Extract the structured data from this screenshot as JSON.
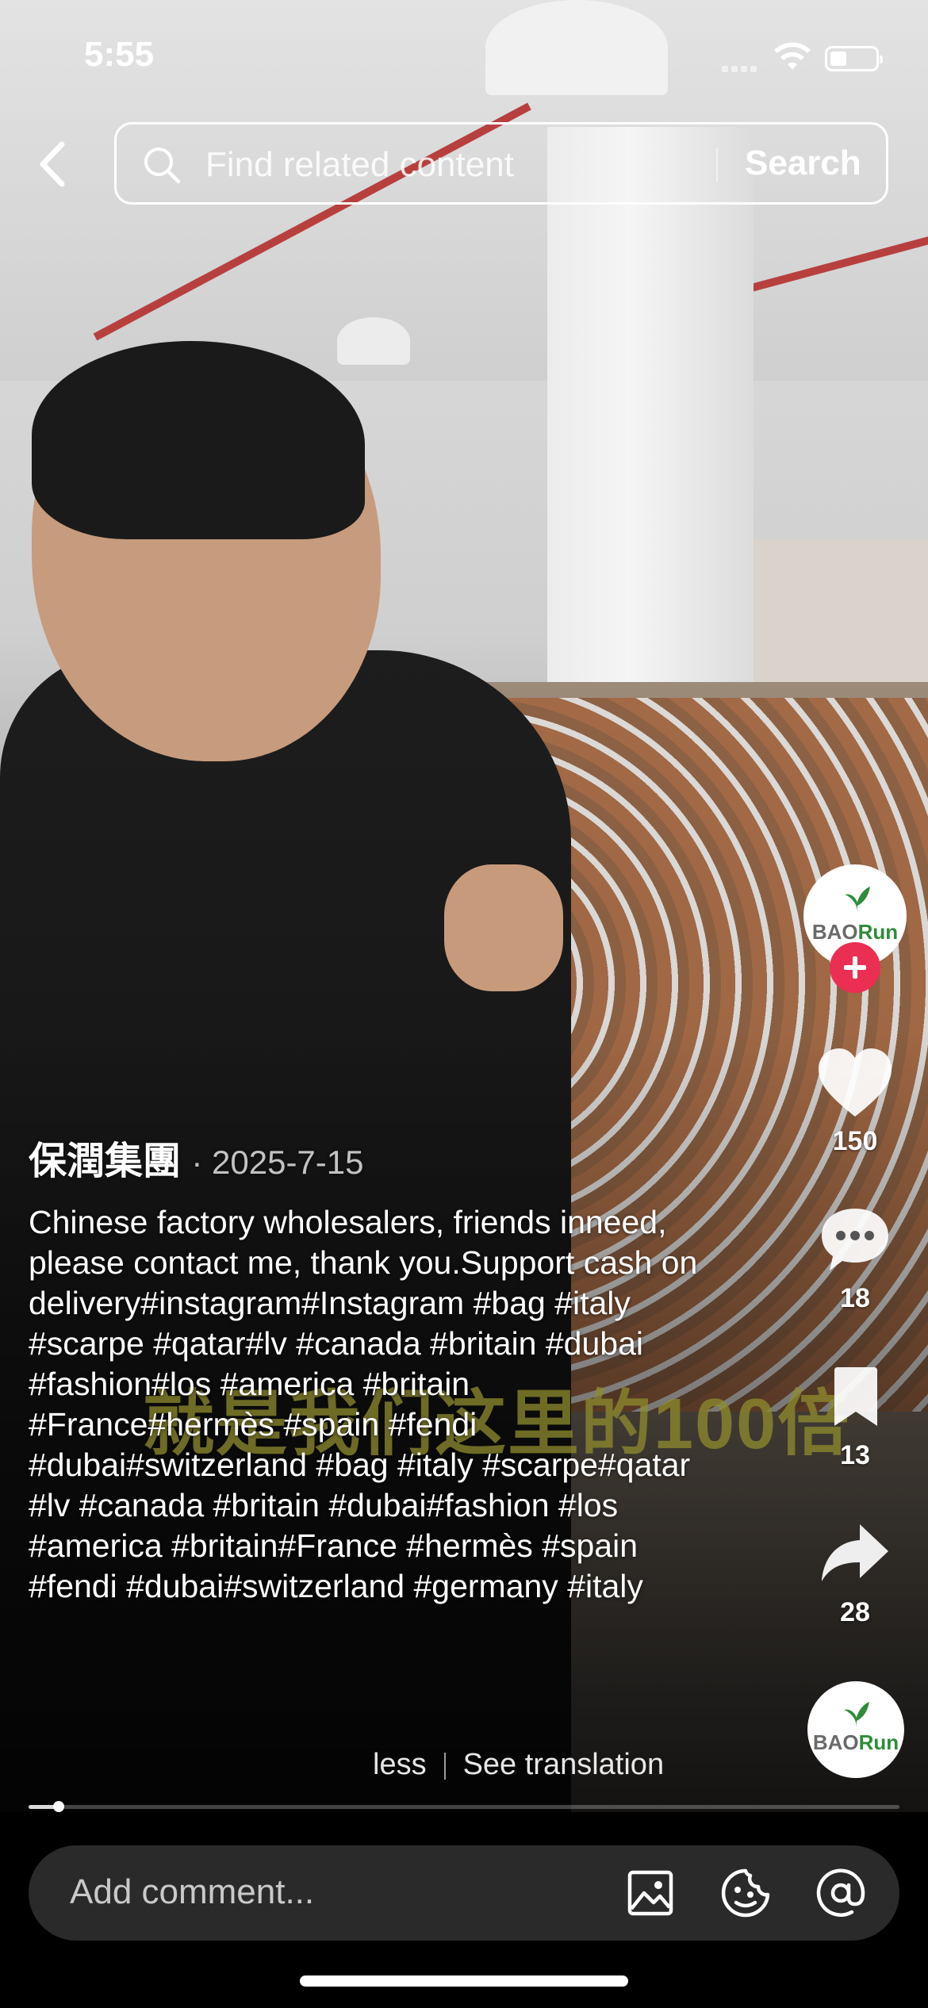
{
  "status_bar": {
    "time": "5:55"
  },
  "search": {
    "placeholder": "Find related content",
    "button_label": "Search"
  },
  "video": {
    "overlay_text": "就是我们这里的100倍"
  },
  "post": {
    "author": "保潤集團",
    "date": "· 2025-7-15",
    "caption": "Chinese factory wholesalers, friends inneed, please contact me, thank you.Support cash on delivery#instagram#Instagram #bag #italy #scarpe #qatar#lv #canada #britain #dubai #fashion#los #america #britain #France#hermès #spain #fendi #dubai#switzerland #bag #italy #scarpe#qatar #lv #canada #britain #dubai#fashion #los #america #britain#France #hermès #spain #fendi #dubai#switzerland #germany #italy",
    "less_label": "less",
    "translate_label": "See translation"
  },
  "actions": {
    "avatar_logo": {
      "left": "BAO",
      "right": "Run"
    },
    "likes": "150",
    "comments": "18",
    "saves": "13",
    "shares": "28"
  },
  "playback": {
    "progress": 0.035
  },
  "comment_bar": {
    "placeholder": "Add comment..."
  },
  "colors": {
    "follow": "#ea2f52",
    "logo_green": "#2f8c3a",
    "comment_bg": "#2a2a2a"
  },
  "icons": [
    "back-icon",
    "search-icon",
    "heart-icon",
    "comment-icon",
    "bookmark-icon",
    "share-icon",
    "image-icon",
    "emoji-icon",
    "mention-icon"
  ]
}
